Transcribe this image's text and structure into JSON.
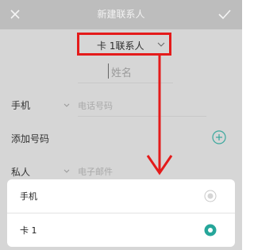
{
  "header": {
    "title": "新建联系人",
    "close_icon": "close-icon",
    "confirm_icon": "checkmark-icon"
  },
  "account": {
    "label": "卡 1联系人",
    "chevron_icon": "chevron-down-icon"
  },
  "name_field": {
    "placeholder": "姓名"
  },
  "phone_row": {
    "label": "手机",
    "placeholder": "电话号码"
  },
  "add_row": {
    "label": "添加号码",
    "icon": "add-circle-icon"
  },
  "email_row": {
    "label": "私人",
    "placeholder": "电子邮件"
  },
  "sheet": {
    "options": [
      {
        "label": "手机",
        "selected": false
      },
      {
        "label": "卡 1",
        "selected": true
      }
    ]
  },
  "colors": {
    "accent": "#26a69a",
    "highlight": "#e41b1b"
  }
}
